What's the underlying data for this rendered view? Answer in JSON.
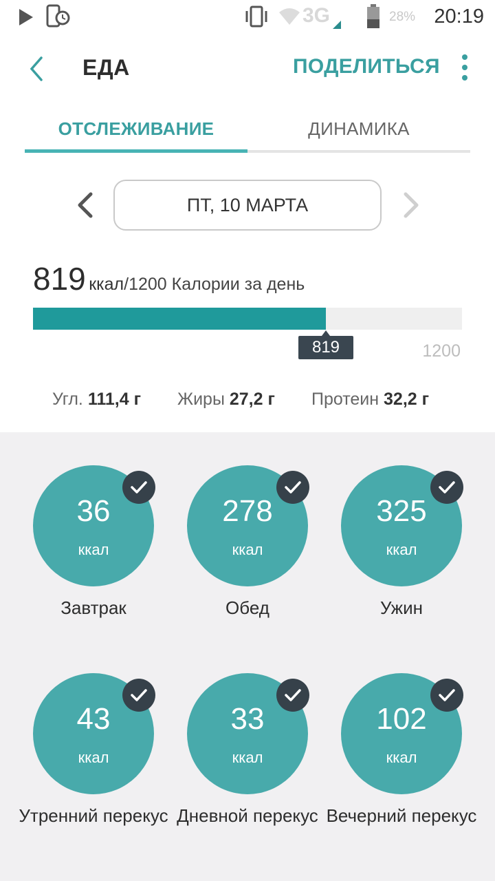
{
  "status_bar": {
    "time": "20:19",
    "network": "3G",
    "battery": "28%",
    "icons": [
      "play-icon",
      "phone-clock-icon",
      "vibrate-icon",
      "wifi-icon",
      "battery-icon"
    ]
  },
  "app_bar": {
    "title": "ЕДА",
    "share_label": "ПОДЕЛИТЬСЯ"
  },
  "tabs": [
    {
      "label": "ОТСЛЕЖИВАНИЕ",
      "active": true
    },
    {
      "label": "ДИНАМИКА",
      "active": false
    }
  ],
  "date": {
    "label": "ПТ, 10 МАРТА"
  },
  "calories": {
    "value": "819",
    "unit": "ккал",
    "rest": "/1200 Калории за день",
    "consumed": 819,
    "goal": 1200,
    "tooltip": "819",
    "max_label": "1200"
  },
  "macros": [
    {
      "label": "Угл.",
      "value": "111,4 г"
    },
    {
      "label": "Жиры",
      "value": "27,2 г"
    },
    {
      "label": "Протеин",
      "value": "32,2 г"
    }
  ],
  "meals": [
    {
      "kcal": "36",
      "unit": "ккал",
      "label": "Завтрак"
    },
    {
      "kcal": "278",
      "unit": "ккал",
      "label": "Обед"
    },
    {
      "kcal": "325",
      "unit": "ккал",
      "label": "Ужин"
    },
    {
      "kcal": "43",
      "unit": "ккал",
      "label": "Утренний перекус"
    },
    {
      "kcal": "33",
      "unit": "ккал",
      "label": "Дневной перекус"
    },
    {
      "kcal": "102",
      "unit": "ккал",
      "label": "Вечерний перекус"
    }
  ],
  "colors": {
    "accent": "#3a9fa0",
    "progress": "#1f9a9b",
    "meal_circle": "#48aaab",
    "check_badge": "#36414a",
    "panel_bg": "#f1f0f2"
  }
}
